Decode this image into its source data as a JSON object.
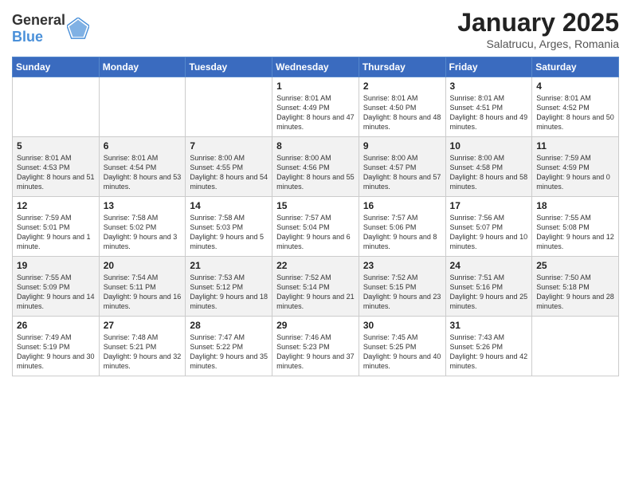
{
  "header": {
    "logo_general": "General",
    "logo_blue": "Blue",
    "title": "January 2025",
    "subtitle": "Salatrucu, Arges, Romania"
  },
  "weekdays": [
    "Sunday",
    "Monday",
    "Tuesday",
    "Wednesday",
    "Thursday",
    "Friday",
    "Saturday"
  ],
  "weeks": [
    [
      {
        "day": "",
        "info": ""
      },
      {
        "day": "",
        "info": ""
      },
      {
        "day": "",
        "info": ""
      },
      {
        "day": "1",
        "info": "Sunrise: 8:01 AM\nSunset: 4:49 PM\nDaylight: 8 hours and 47 minutes."
      },
      {
        "day": "2",
        "info": "Sunrise: 8:01 AM\nSunset: 4:50 PM\nDaylight: 8 hours and 48 minutes."
      },
      {
        "day": "3",
        "info": "Sunrise: 8:01 AM\nSunset: 4:51 PM\nDaylight: 8 hours and 49 minutes."
      },
      {
        "day": "4",
        "info": "Sunrise: 8:01 AM\nSunset: 4:52 PM\nDaylight: 8 hours and 50 minutes."
      }
    ],
    [
      {
        "day": "5",
        "info": "Sunrise: 8:01 AM\nSunset: 4:53 PM\nDaylight: 8 hours and 51 minutes."
      },
      {
        "day": "6",
        "info": "Sunrise: 8:01 AM\nSunset: 4:54 PM\nDaylight: 8 hours and 53 minutes."
      },
      {
        "day": "7",
        "info": "Sunrise: 8:00 AM\nSunset: 4:55 PM\nDaylight: 8 hours and 54 minutes."
      },
      {
        "day": "8",
        "info": "Sunrise: 8:00 AM\nSunset: 4:56 PM\nDaylight: 8 hours and 55 minutes."
      },
      {
        "day": "9",
        "info": "Sunrise: 8:00 AM\nSunset: 4:57 PM\nDaylight: 8 hours and 57 minutes."
      },
      {
        "day": "10",
        "info": "Sunrise: 8:00 AM\nSunset: 4:58 PM\nDaylight: 8 hours and 58 minutes."
      },
      {
        "day": "11",
        "info": "Sunrise: 7:59 AM\nSunset: 4:59 PM\nDaylight: 9 hours and 0 minutes."
      }
    ],
    [
      {
        "day": "12",
        "info": "Sunrise: 7:59 AM\nSunset: 5:01 PM\nDaylight: 9 hours and 1 minute."
      },
      {
        "day": "13",
        "info": "Sunrise: 7:58 AM\nSunset: 5:02 PM\nDaylight: 9 hours and 3 minutes."
      },
      {
        "day": "14",
        "info": "Sunrise: 7:58 AM\nSunset: 5:03 PM\nDaylight: 9 hours and 5 minutes."
      },
      {
        "day": "15",
        "info": "Sunrise: 7:57 AM\nSunset: 5:04 PM\nDaylight: 9 hours and 6 minutes."
      },
      {
        "day": "16",
        "info": "Sunrise: 7:57 AM\nSunset: 5:06 PM\nDaylight: 9 hours and 8 minutes."
      },
      {
        "day": "17",
        "info": "Sunrise: 7:56 AM\nSunset: 5:07 PM\nDaylight: 9 hours and 10 minutes."
      },
      {
        "day": "18",
        "info": "Sunrise: 7:55 AM\nSunset: 5:08 PM\nDaylight: 9 hours and 12 minutes."
      }
    ],
    [
      {
        "day": "19",
        "info": "Sunrise: 7:55 AM\nSunset: 5:09 PM\nDaylight: 9 hours and 14 minutes."
      },
      {
        "day": "20",
        "info": "Sunrise: 7:54 AM\nSunset: 5:11 PM\nDaylight: 9 hours and 16 minutes."
      },
      {
        "day": "21",
        "info": "Sunrise: 7:53 AM\nSunset: 5:12 PM\nDaylight: 9 hours and 18 minutes."
      },
      {
        "day": "22",
        "info": "Sunrise: 7:52 AM\nSunset: 5:14 PM\nDaylight: 9 hours and 21 minutes."
      },
      {
        "day": "23",
        "info": "Sunrise: 7:52 AM\nSunset: 5:15 PM\nDaylight: 9 hours and 23 minutes."
      },
      {
        "day": "24",
        "info": "Sunrise: 7:51 AM\nSunset: 5:16 PM\nDaylight: 9 hours and 25 minutes."
      },
      {
        "day": "25",
        "info": "Sunrise: 7:50 AM\nSunset: 5:18 PM\nDaylight: 9 hours and 28 minutes."
      }
    ],
    [
      {
        "day": "26",
        "info": "Sunrise: 7:49 AM\nSunset: 5:19 PM\nDaylight: 9 hours and 30 minutes."
      },
      {
        "day": "27",
        "info": "Sunrise: 7:48 AM\nSunset: 5:21 PM\nDaylight: 9 hours and 32 minutes."
      },
      {
        "day": "28",
        "info": "Sunrise: 7:47 AM\nSunset: 5:22 PM\nDaylight: 9 hours and 35 minutes."
      },
      {
        "day": "29",
        "info": "Sunrise: 7:46 AM\nSunset: 5:23 PM\nDaylight: 9 hours and 37 minutes."
      },
      {
        "day": "30",
        "info": "Sunrise: 7:45 AM\nSunset: 5:25 PM\nDaylight: 9 hours and 40 minutes."
      },
      {
        "day": "31",
        "info": "Sunrise: 7:43 AM\nSunset: 5:26 PM\nDaylight: 9 hours and 42 minutes."
      },
      {
        "day": "",
        "info": ""
      }
    ]
  ]
}
